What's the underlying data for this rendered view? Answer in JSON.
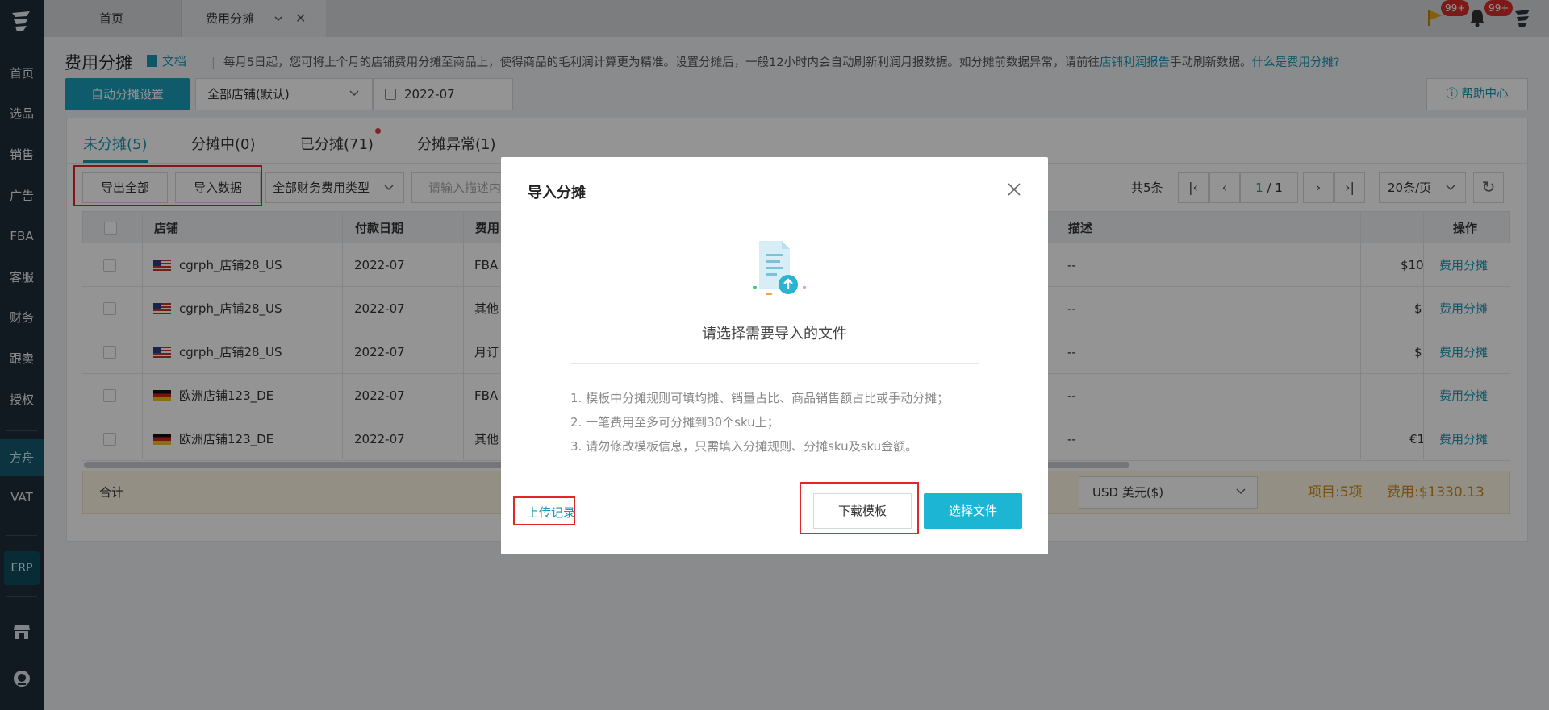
{
  "sidebar": {
    "items": [
      {
        "label": "首页"
      },
      {
        "label": "选品"
      },
      {
        "label": "销售"
      },
      {
        "label": "广告"
      },
      {
        "label": "FBA"
      },
      {
        "label": "客服"
      },
      {
        "label": "财务"
      },
      {
        "label": "跟卖"
      },
      {
        "label": "授权"
      },
      {
        "label": "方舟"
      },
      {
        "label": "VAT"
      }
    ],
    "erp_label": "ERP"
  },
  "topbar": {
    "tabs": [
      {
        "label": "首页"
      },
      {
        "label": "费用分摊"
      }
    ],
    "badges": [
      "99+",
      "99+"
    ]
  },
  "header": {
    "title": "费用分摊",
    "doc_link": "文档",
    "separator": "|",
    "notice_text": "每月5日起，您可将上个月的店铺费用分摊至商品上，使得商品的毛利润计算更为精准。设置分摊后，一般12小时内会自动刷新利润月报数据。如分摊前数据异常，请前往",
    "notice_link": "店铺利润报告",
    "notice_after": "手动刷新数据。",
    "notice_question": "什么是费用分摊?",
    "auto_btn": "自动分摊设置",
    "store_select": "全部店铺(默认)",
    "date_value": "2022-07",
    "help_btn": "帮助中心"
  },
  "tabs": [
    {
      "label": "未分摊(5)",
      "active": true
    },
    {
      "label": "分摊中(0)"
    },
    {
      "label": "已分摊(71)"
    },
    {
      "label": "分摊异常(1)"
    }
  ],
  "toolbar": {
    "export_all": "导出全部",
    "import_data": "导入数据",
    "fee_type_select": "全部财务费用类型",
    "search_placeholder": "请输入描述内容"
  },
  "pager": {
    "total": "共5条",
    "current": "1",
    "total_pages": "/ 1",
    "page_size": "20条/页"
  },
  "table": {
    "headers": [
      "店铺",
      "付款日期",
      "费用",
      "描述",
      "操作"
    ],
    "rows": [
      {
        "flag": "us",
        "store": "cgrph_店铺28_US",
        "date": "2022-07",
        "fee": "FBA",
        "desc": "--",
        "amount": "$10",
        "op": "费用分摊"
      },
      {
        "flag": "us",
        "store": "cgrph_店铺28_US",
        "date": "2022-07",
        "fee": "其他",
        "desc": "--",
        "amount": "$",
        "op": "费用分摊"
      },
      {
        "flag": "us",
        "store": "cgrph_店铺28_US",
        "date": "2022-07",
        "fee": "月订",
        "desc": "--",
        "amount": "$",
        "op": "费用分摊"
      },
      {
        "flag": "de",
        "store": "欧洲店铺123_DE",
        "date": "2022-07",
        "fee": "FBA",
        "desc": "--",
        "amount": "",
        "op": "费用分摊"
      },
      {
        "flag": "de",
        "store": "欧洲店铺123_DE",
        "date": "2022-07",
        "fee": "其他",
        "desc": "--",
        "amount": "€1",
        "op": "费用分摊"
      }
    ],
    "footer": {
      "sum_label": "合计",
      "currency": "USD  美元($)",
      "items": "项目:5项",
      "fee_total": "费用:$1330.13"
    }
  },
  "modal": {
    "title": "导入分摊",
    "subtitle": "请选择需要导入的文件",
    "tips": [
      "1. 模板中分摊规则可填均摊、销量占比、商品销售额占比或手动分摊；",
      "2. 一笔费用至多可分摊到30个sku上；",
      "3. 请勿修改模板信息，只需填入分摊规则、分摊sku及sku金额。"
    ],
    "upload_record": "上传记录",
    "download_template": "下载模板",
    "choose_file": "选择文件"
  },
  "colors": {
    "accent": "#1996b4",
    "primary_button": "#1cb6d4",
    "highlight_box": "#e2262b",
    "sidebar_bg": "#1f2d3a"
  },
  "icons": [
    "logo-icon",
    "flag-icon",
    "bell-icon",
    "avatar-icon",
    "calendar-icon",
    "help-circle-icon",
    "refresh-icon",
    "store-icon",
    "support-icon",
    "close-icon",
    "file-upload-icon",
    "chevron-down-icon"
  ]
}
